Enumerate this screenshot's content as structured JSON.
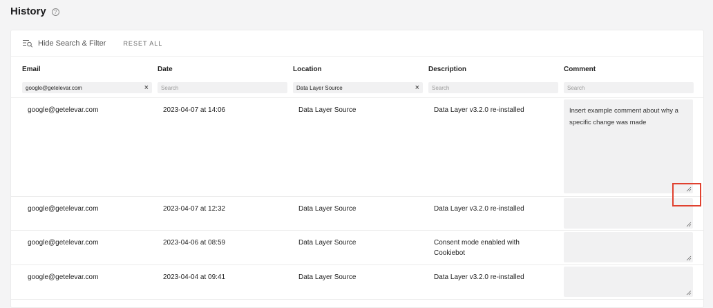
{
  "page": {
    "title": "History",
    "help_icon": "question-circle-icon"
  },
  "toolbar": {
    "filter_toggle_label": "Hide Search & Filter",
    "reset_label": "RESET ALL"
  },
  "columns": [
    {
      "label": "Email"
    },
    {
      "label": "Date"
    },
    {
      "label": "Location"
    },
    {
      "label": "Description"
    },
    {
      "label": "Comment"
    }
  ],
  "filters": {
    "email": {
      "value": "google@getelevar.com"
    },
    "date": {
      "placeholder": "Search"
    },
    "location": {
      "value": "Data Layer Source"
    },
    "description": {
      "placeholder": "Search"
    },
    "comment": {
      "placeholder": "Search"
    }
  },
  "rows": [
    {
      "email": "google@getelevar.com",
      "date": "2023-04-07 at 14:06",
      "location": "Data Layer Source",
      "description": "Data Layer v3.2.0 re-installed",
      "comment": "Insert example comment about why a specific change was made"
    },
    {
      "email": "google@getelevar.com",
      "date": "2023-04-07 at 12:32",
      "location": "Data Layer Source",
      "description": "Data Layer v3.2.0 re-installed",
      "comment": ""
    },
    {
      "email": "google@getelevar.com",
      "date": "2023-04-06 at 08:59",
      "location": "Data Layer Source",
      "description": "Consent mode enabled with Cookiebot",
      "comment": ""
    },
    {
      "email": "google@getelevar.com",
      "date": "2023-04-04 at 09:41",
      "location": "Data Layer Source",
      "description": "Data Layer v3.2.0 re-installed",
      "comment": ""
    }
  ],
  "colors": {
    "highlight": "#e0412f",
    "input_bg": "#f1f1f2"
  }
}
